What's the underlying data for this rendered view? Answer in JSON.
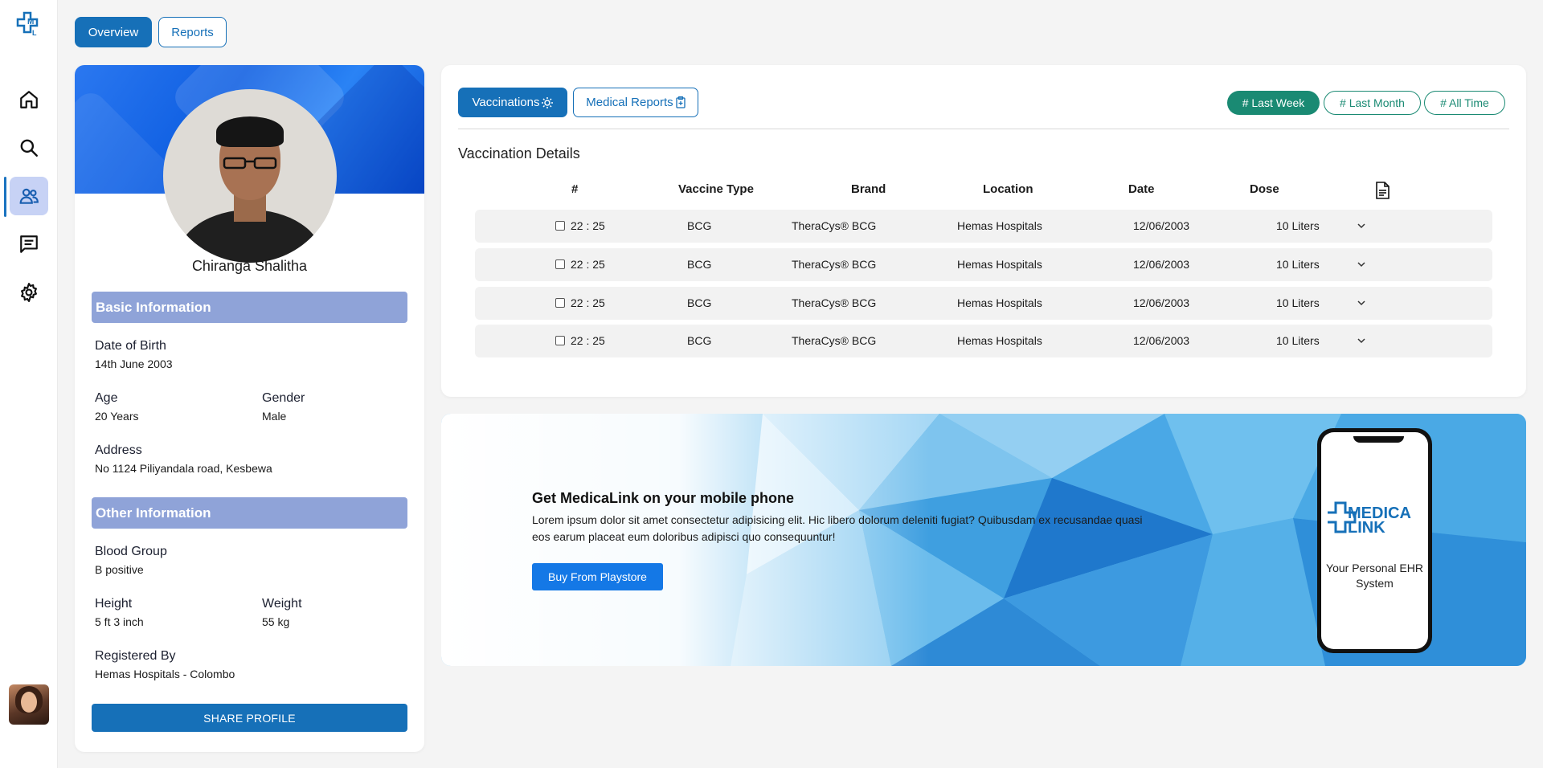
{
  "nav": {
    "items": [
      "home-icon",
      "search-icon",
      "users-icon",
      "chat-icon",
      "settings-icon"
    ],
    "active": "users-icon"
  },
  "top_tabs": {
    "overview": "Overview",
    "reports": "Reports"
  },
  "profile": {
    "name": "Chiranga Shalitha",
    "basic_header": "Basic Information",
    "other_header": "Other Information",
    "dob_label": "Date of Birth",
    "dob_value": "14th June 2003",
    "age_label": "Age",
    "age_value": "20 Years",
    "gender_label": "Gender",
    "gender_value": "Male",
    "address_label": "Address",
    "address_value": "No 1124 Piliyandala road, Kesbewa",
    "blood_label": "Blood Group",
    "blood_value": "B positive",
    "height_label": "Height",
    "height_value": "5 ft 3 inch",
    "weight_label": "Weight",
    "weight_value": "55 kg",
    "registered_label": "Registered By",
    "registered_value": "Hemas Hospitals - Colombo",
    "share_button": "SHARE PROFILE"
  },
  "vaccinations": {
    "tab_vaccinations": "Vaccinations",
    "tab_medical_reports": "Medical Reports",
    "filters": [
      "# Last Week",
      "# Last Month",
      "# All Time"
    ],
    "title": "Vaccination Details",
    "columns": [
      "#",
      "Vaccine Type",
      "Brand",
      "Location",
      "Date",
      "Dose"
    ],
    "rows": [
      {
        "time": "22 : 25",
        "type": "BCG",
        "brand": "TheraCys® BCG",
        "location": "Hemas Hospitals",
        "date": "12/06/2003",
        "dose": "10 Liters"
      },
      {
        "time": "22 : 25",
        "type": "BCG",
        "brand": "TheraCys® BCG",
        "location": "Hemas Hospitals",
        "date": "12/06/2003",
        "dose": "10 Liters"
      },
      {
        "time": "22 : 25",
        "type": "BCG",
        "brand": "TheraCys® BCG",
        "location": "Hemas Hospitals",
        "date": "12/06/2003",
        "dose": "10 Liters"
      },
      {
        "time": "22 : 25",
        "type": "BCG",
        "brand": "TheraCys® BCG",
        "location": "Hemas Hospitals",
        "date": "12/06/2003",
        "dose": "10 Liters"
      }
    ]
  },
  "promo": {
    "title": "Get MedicaLink on your mobile phone",
    "text": "Lorem ipsum dolor sit amet consectetur adipisicing elit. Hic libero dolorum deleniti fugiat? Quibusdam ex recusandae quasi eos earum placeat eum doloribus adipisci quo consequuntur!",
    "button": "Buy From Playstore",
    "phone_brand_line1": "MEDICA",
    "phone_brand_line2": "LINK",
    "phone_tagline": "Your Personal EHR System"
  },
  "colors": {
    "primary": "#1670b8",
    "section_header": "#8fa3d8",
    "filter_green": "#1a8a73",
    "playstore_button": "#1478e6"
  }
}
